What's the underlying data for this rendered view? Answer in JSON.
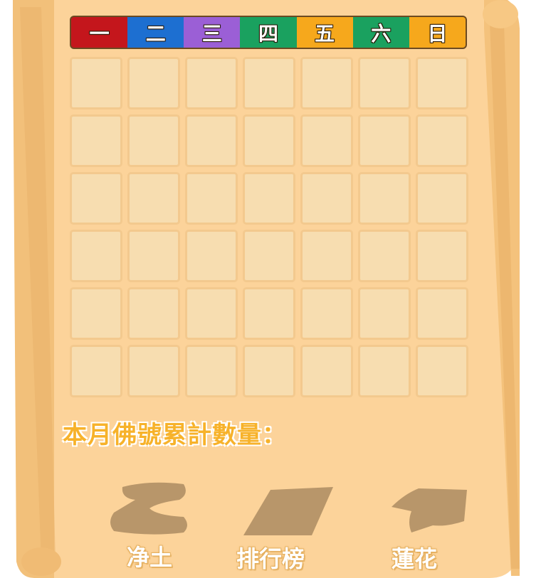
{
  "weekdays": [
    {
      "label": "一",
      "color": "#c4161c"
    },
    {
      "label": "二",
      "color": "#1d6fd1"
    },
    {
      "label": "三",
      "color": "#9b5fd6"
    },
    {
      "label": "四",
      "color": "#1aa15f"
    },
    {
      "label": "五",
      "color": "#f6a81c"
    },
    {
      "label": "六",
      "color": "#1aa15f"
    },
    {
      "label": "日",
      "color": "#f6a81c"
    }
  ],
  "grid": {
    "rows": 6,
    "cols": 7
  },
  "count_label": "本月佛號累計數量：",
  "nav": {
    "pure_land": "净土",
    "ranking": "排行榜",
    "lotus": "蓮花"
  },
  "colors": {
    "parchment": "#fcd39a",
    "cell": "#f7ddb0",
    "cell_border": "#f3c98e",
    "count_text": "#f7b22a",
    "shadow_icon": "#b8966a"
  }
}
